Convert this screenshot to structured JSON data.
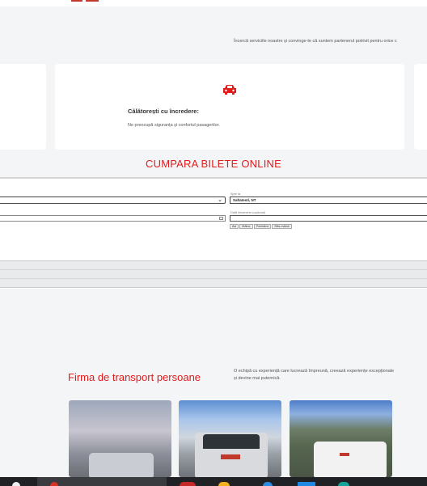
{
  "promo": {
    "text": "Încercă serviciile noastre și convinge-te că suntem partenerul potrivit pentru orice c"
  },
  "feature_card": {
    "icon": "car-icon",
    "title": "Călătorești cu încredere:",
    "text": "Ne preocupă siguranța și confortul pasagerilor."
  },
  "booking": {
    "section_title": "CUMPARA BILETE ONLINE",
    "to_label": "Spre la",
    "to_value": "Saltatesti, NT",
    "return_label": "Dată întoarcere (opțional)",
    "date_buttons": [
      "Azi",
      "Mâine",
      "Poimâine",
      "Răs-mâine"
    ]
  },
  "company": {
    "title": "Firma de transport persoane",
    "description": "O echipă cu experiență care lucrează împreună, creează experiențe excepționale și devine mai puternică."
  },
  "colors": {
    "accent": "#e21b1b",
    "background": "#f4f5f7",
    "taskbar": "#202124"
  },
  "taskbar": {
    "icons": [
      "chrome-icon",
      "app-red-icon",
      "file-explorer-icon",
      "edge-icon",
      "store-icon",
      "app-teal-icon"
    ]
  }
}
